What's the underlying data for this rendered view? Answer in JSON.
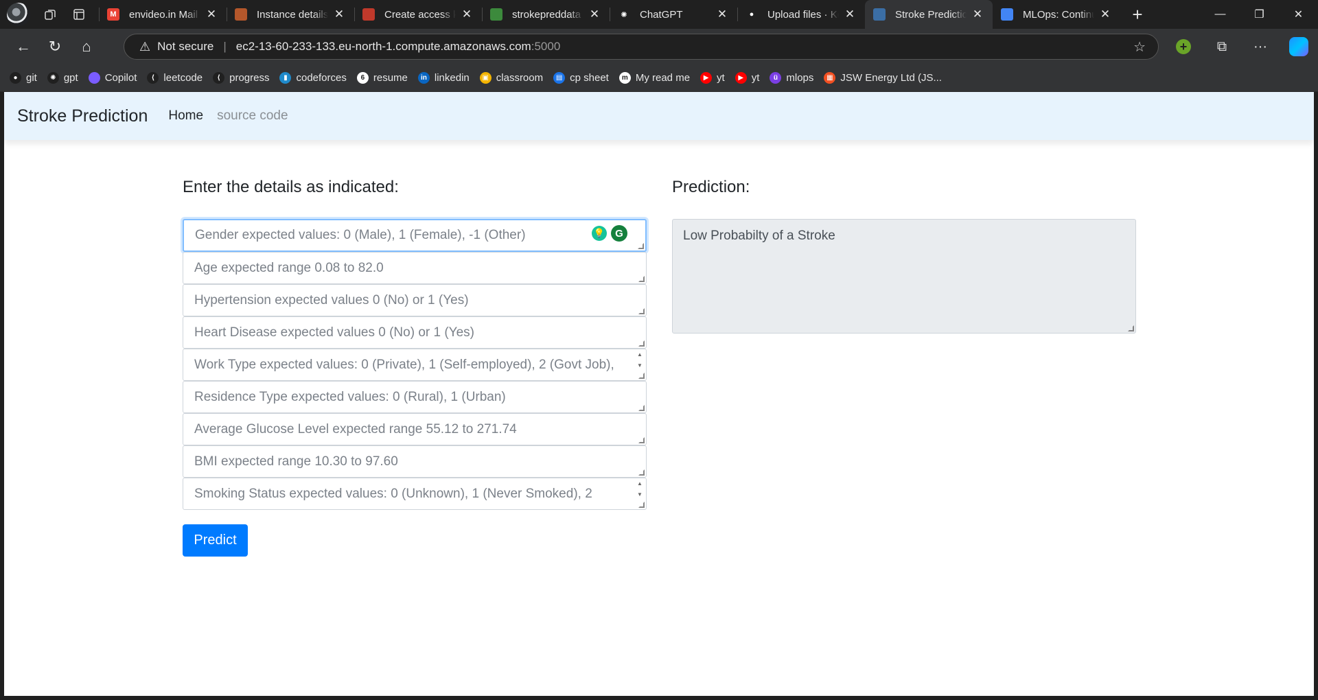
{
  "browser": {
    "tabs": [
      {
        "title": "envideo.in Mail",
        "favicon_color": "#ea4335",
        "favicon_glyph": "M"
      },
      {
        "title": "Instance details |",
        "favicon_color": "#b4572b",
        "favicon_glyph": ""
      },
      {
        "title": "Create access ke",
        "favicon_color": "#c0392b",
        "favicon_glyph": ""
      },
      {
        "title": "strokepreddata -",
        "favicon_color": "#3c8a3c",
        "favicon_glyph": ""
      },
      {
        "title": "ChatGPT",
        "favicon_color": "#202020",
        "favicon_glyph": "✺"
      },
      {
        "title": "Upload files · Ke",
        "favicon_color": "#202020",
        "favicon_glyph": "●"
      },
      {
        "title": "Stroke Predictior",
        "favicon_color": "#3b6ea5",
        "favicon_glyph": ""
      },
      {
        "title": "MLOps: Continu",
        "favicon_color": "#4285f4",
        "favicon_glyph": ""
      }
    ],
    "active_tab_index": 6,
    "address": {
      "security_label": "Not secure",
      "host": "ec2-13-60-233-133.eu-north-1.compute.amazonaws.com",
      "port": ":5000"
    },
    "bookmarks": [
      {
        "label": "git",
        "color": "#202020",
        "glyph": "●"
      },
      {
        "label": "gpt",
        "color": "#202020",
        "glyph": "✺"
      },
      {
        "label": "Copilot",
        "color": "#7a5cff",
        "glyph": ""
      },
      {
        "label": "leetcode",
        "color": "#202020",
        "glyph": "⟨"
      },
      {
        "label": "progress",
        "color": "#202020",
        "glyph": "⟨"
      },
      {
        "label": "codeforces",
        "color": "#1f8acb",
        "glyph": "▮"
      },
      {
        "label": "resume",
        "color": "#ffffff",
        "glyph": "6"
      },
      {
        "label": "linkedin",
        "color": "#0a66c2",
        "glyph": "in"
      },
      {
        "label": "classroom",
        "color": "#f4b400",
        "glyph": "▣"
      },
      {
        "label": "cp sheet",
        "color": "#1a73e8",
        "glyph": "▤"
      },
      {
        "label": "My read me",
        "color": "#ffffff",
        "glyph": "m"
      },
      {
        "label": "yt",
        "color": "#ff0000",
        "glyph": "▶"
      },
      {
        "label": "yt",
        "color": "#ff0000",
        "glyph": "▶"
      },
      {
        "label": "mlops",
        "color": "#7b3fe4",
        "glyph": "ü"
      },
      {
        "label": "JSW Energy Ltd (JS...",
        "color": "#f25022",
        "glyph": "▦"
      }
    ]
  },
  "app": {
    "brand": "Stroke Prediction",
    "nav": {
      "home": "Home",
      "source": "source code"
    },
    "form": {
      "heading": "Enter the details as indicated:",
      "fields": [
        {
          "placeholder": "Gender expected values: 0 (Male), 1 (Female), -1 (Other)"
        },
        {
          "placeholder": "Age expected range 0.08 to 82.0"
        },
        {
          "placeholder": "Hypertension expected values 0 (No) or 1 (Yes)"
        },
        {
          "placeholder": "Heart Disease expected values 0 (No) or 1 (Yes)"
        },
        {
          "placeholder": "Work Type expected values: 0 (Private), 1 (Self-employed), 2 (Govt Job),"
        },
        {
          "placeholder": "Residence Type expected values: 0 (Rural), 1 (Urban)"
        },
        {
          "placeholder": "Average Glucose Level expected range 55.12 to 271.74"
        },
        {
          "placeholder": "BMI expected range 10.30 to 97.60"
        },
        {
          "placeholder": "Smoking Status expected values: 0 (Unknown), 1 (Never Smoked), 2"
        }
      ],
      "submit_label": "Predict"
    },
    "prediction": {
      "heading": "Prediction:",
      "result": "Low Probabilty of a Stroke"
    }
  }
}
